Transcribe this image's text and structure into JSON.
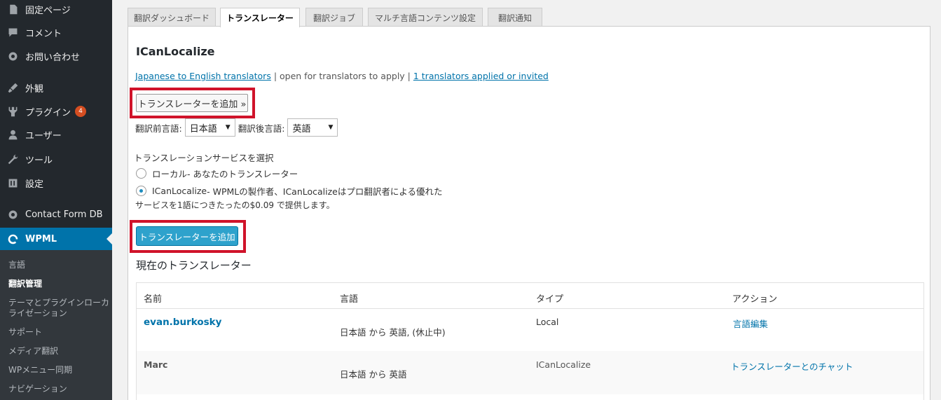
{
  "sidebar": {
    "items": [
      {
        "label": "固定ページ",
        "icon": "page-icon"
      },
      {
        "label": "コメント",
        "icon": "comment-icon"
      },
      {
        "label": "お問い合わせ",
        "icon": "gear-icon"
      },
      {
        "label": "外観",
        "icon": "brush-icon"
      },
      {
        "label": "プラグイン",
        "icon": "plugin-icon",
        "badge": "4"
      },
      {
        "label": "ユーザー",
        "icon": "user-icon"
      },
      {
        "label": "ツール",
        "icon": "wrench-icon"
      },
      {
        "label": "設定",
        "icon": "settings-icon"
      },
      {
        "label": "Contact Form DB",
        "icon": "gear-icon"
      },
      {
        "label": "WPML",
        "icon": "wpml-icon"
      }
    ],
    "submenu": [
      "言語",
      "翻訳管理",
      "テーマとプラグインローカライゼーション",
      "サポート",
      "メディア翻訳",
      "WPメニュー同期",
      "ナビゲーション"
    ]
  },
  "tabs": [
    "翻訳ダッシュボード",
    "トランスレーター",
    "翻訳ジョブ",
    "マルチ言語コンテンツ設定",
    "翻訳通知"
  ],
  "panel": {
    "title": "ICanLocalize",
    "link1": "Japanese to English translators",
    "sep1": " | open for translators to apply | ",
    "link2": "1 translators applied or invited",
    "add_gray_label": "トランスレーターを追加 »",
    "from_label": "翻訳前言語:",
    "from_value": "日本語",
    "to_label": "翻訳後言語:",
    "to_value": "英語",
    "service_label": "トランスレーションサービスを選択",
    "opt_local_name": "ローカル",
    "opt_local_desc": " - あなたのトランスレーター",
    "opt_icl_name": "ICanLocalize",
    "opt_icl_desc": " - WPMLの製作者、ICanLocalizeはプロ翻訳者による優れた",
    "opt_icl_desc2": "サービスを1語につきたったの$0.09 で提供します。",
    "add_blue_label": "トランスレーターを追加",
    "current_title": "現在のトランスレーター"
  },
  "table": {
    "headers": [
      "名前",
      "言語",
      "タイプ",
      "アクション"
    ],
    "rows": [
      {
        "name": "evan.burkosky",
        "lang": "日本語 から 英語, (休止中)",
        "type": "Local",
        "action": "言語編集"
      },
      {
        "name": "Marc",
        "lang": "日本語 から 英語",
        "type": "ICanLocalize",
        "action": "トランスレーターとのチャット"
      }
    ]
  }
}
